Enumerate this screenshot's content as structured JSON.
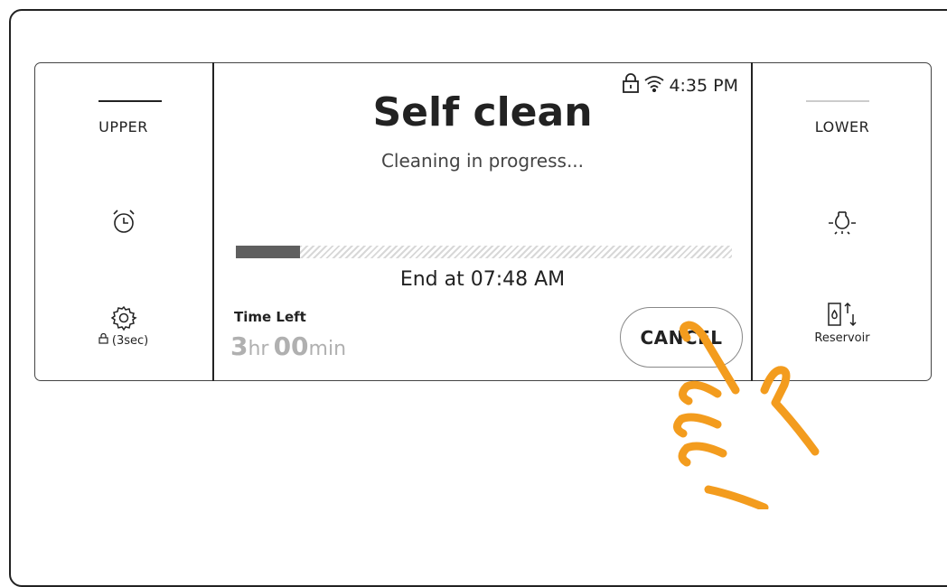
{
  "upper": {
    "label": "UPPER",
    "alarm_icon": "alarm-clock-icon",
    "settings_icon": "gear-icon",
    "settings_lock_label": "(3sec)"
  },
  "lower": {
    "label": "LOWER",
    "light_icon": "light-bulb-icon",
    "reservoir_label": "Reservoir"
  },
  "status": {
    "lock_icon": "lock-icon",
    "wifi_icon": "wifi-icon",
    "time": "4:35 PM"
  },
  "main": {
    "title": "Self clean",
    "subtitle": "Cleaning in progress...",
    "progress_fraction": 0.13,
    "end_time": "End at 07:48 AM",
    "time_left_label": "Time Left",
    "time_left_hours": "3",
    "time_left_hours_unit": "hr",
    "time_left_minutes": "00",
    "time_left_minutes_unit": "min",
    "cancel_label": "CANCEL"
  },
  "colors": {
    "accent_hand": "#f39c1e",
    "progress_fill": "#5f5f5f",
    "dim_text": "#b0b0b0"
  }
}
